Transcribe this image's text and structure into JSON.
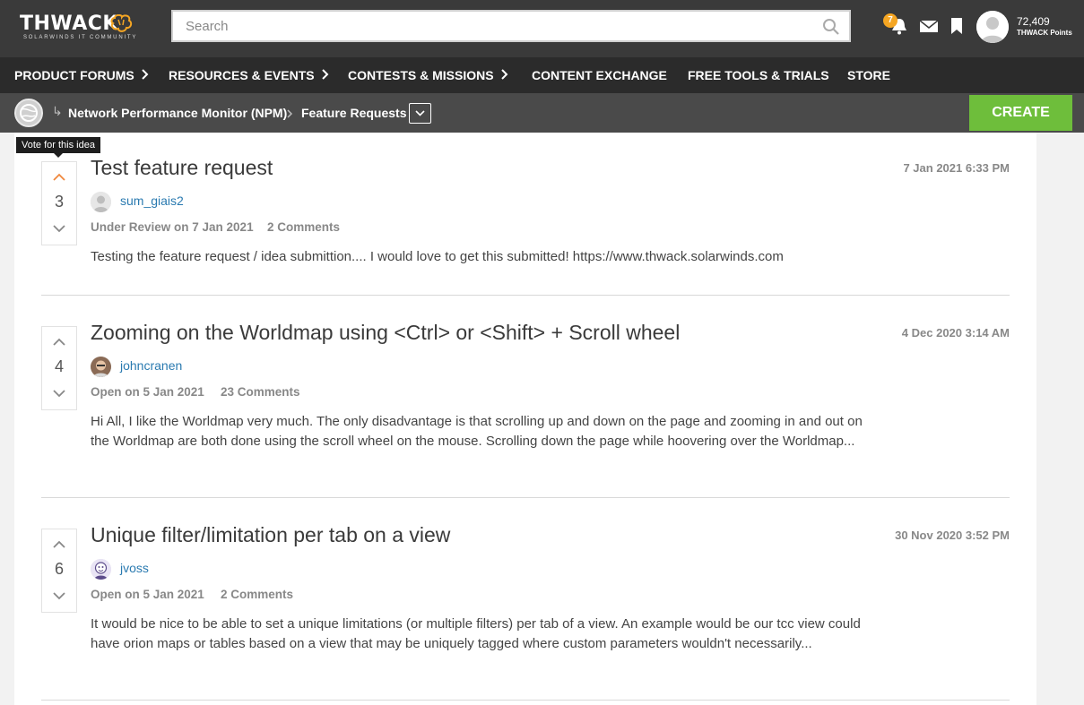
{
  "header": {
    "logo_text": "THWACK",
    "logo_sub": "SOLARWINDS IT COMMUNITY",
    "search_placeholder": "Search",
    "notification_count": "7",
    "points_value": "72,409",
    "points_label": "THWACK Points"
  },
  "nav": {
    "items": [
      {
        "label": "PRODUCT FORUMS",
        "has_submenu": true
      },
      {
        "label": "RESOURCES & EVENTS",
        "has_submenu": true
      },
      {
        "label": "CONTESTS & MISSIONS",
        "has_submenu": true
      },
      {
        "label": "CONTENT EXCHANGE",
        "has_submenu": false
      },
      {
        "label": "FREE TOOLS & TRIALS",
        "has_submenu": false
      },
      {
        "label": "STORE",
        "has_submenu": false
      }
    ]
  },
  "breadcrumb": {
    "items": [
      "Network Performance Monitor (NPM)",
      "Feature Requests"
    ],
    "create_label": "CREATE"
  },
  "tooltip": "Vote for this idea",
  "ideas": [
    {
      "votes": "3",
      "title": "Test feature request",
      "date": "7 Jan 2021 6:33 PM",
      "author": "sum_giais2",
      "status": "Under Review on 7 Jan 2021",
      "comments": "2 Comments",
      "body": "Testing the feature request / idea submittion.... I would love to get this submitted! https://www.thwack.solarwinds.com"
    },
    {
      "votes": "4",
      "title": "Zooming on the Worldmap using <Ctrl> or <Shift> + Scroll wheel",
      "date": "4 Dec 2020 3:14 AM",
      "author": "johncranen",
      "status": "Open on 5 Jan 2021",
      "comments": "23 Comments",
      "body": "Hi All, I like the Worldmap very much. The only disadvantage is that scrolling up and down on the page and zooming in and out on the Worldmap are both done using the scroll wheel on the mouse. Scrolling down the page while hoovering over the Worldmap..."
    },
    {
      "votes": "6",
      "title": "Unique filter/limitation per tab on a view",
      "date": "30 Nov 2020 3:52 PM",
      "author": "jvoss",
      "status": "Open on 5 Jan 2021",
      "comments": "2 Comments",
      "body": "It would be nice to be able to set a unique limitations (or multiple filters) per tab of a view. An example would be our tcc view could have orion maps or tables based on a view that may be uniquely tagged where custom parameters wouldn't necessarily..."
    }
  ],
  "colors": {
    "topbar": "#3a3a3a",
    "navbar": "#2b2b2b",
    "crumbbar": "#4a4a4a",
    "create": "#6ebe3b",
    "link": "#2a7ab0",
    "vote_active": "#f0883e",
    "badge": "#f5a623"
  }
}
